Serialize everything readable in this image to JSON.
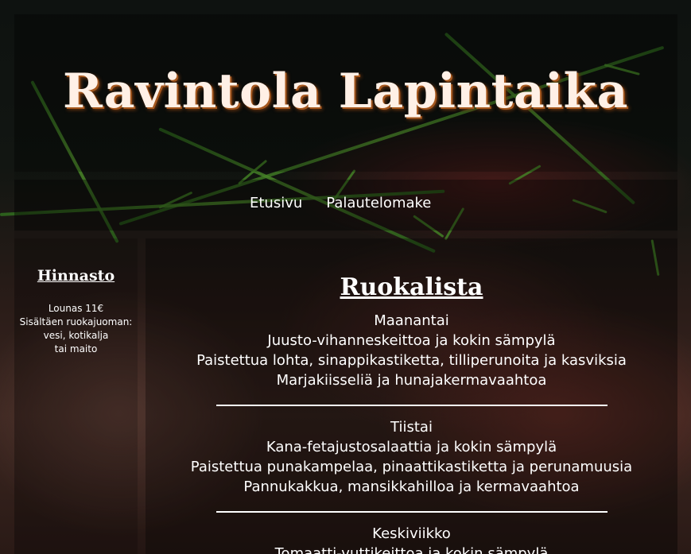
{
  "site": {
    "title": "Ravintola Lapintaika"
  },
  "nav": {
    "items": [
      {
        "label": "Etusivu"
      },
      {
        "label": "Palautelomake"
      }
    ]
  },
  "sidebar": {
    "heading": "Hinnasto",
    "lines": [
      "Lounas 11€",
      "Sisältäen ruokajuoman:",
      "vesi, kotikalja",
      "tai maito"
    ]
  },
  "menu": {
    "title": "Ruokalista",
    "days": [
      {
        "name": "Maanantai",
        "dishes": [
          "Juusto-vihanneskeittoa ja kokin sämpylä",
          "Paistettua lohta, sinappikastiketta, tilliperunoita ja kasviksia",
          "Marjakiisseliä ja hunajakermavaahtoa"
        ]
      },
      {
        "name": "Tiistai",
        "dishes": [
          "Kana-fetajustosalaattia ja kokin sämpylä",
          "Paistettua punakampelaa, pinaattikastiketta ja perunamuusia",
          "Pannukakkua, mansikkahilloa ja kermavaahtoa"
        ]
      },
      {
        "name": "Keskiviikko",
        "dishes": [
          "Tomaatti-vuttikeittoa ja kokin sämpylä"
        ]
      }
    ]
  }
}
